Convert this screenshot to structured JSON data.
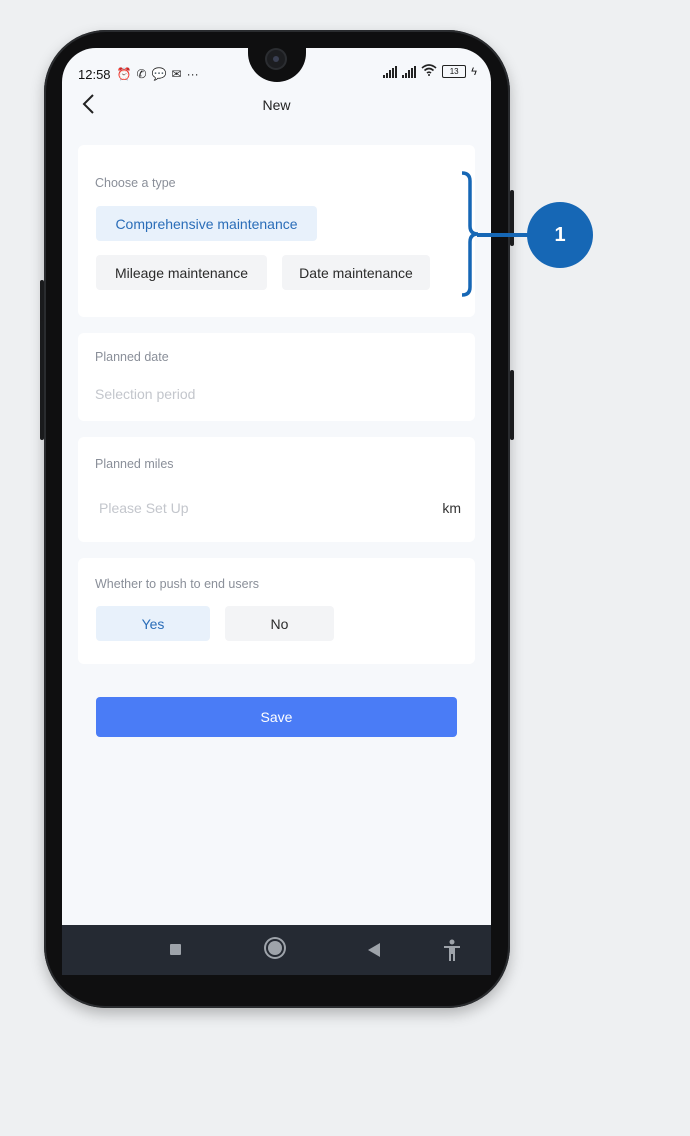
{
  "status_bar": {
    "time": "12:58",
    "battery": "13"
  },
  "header": {
    "title": "New"
  },
  "type_section": {
    "label": "Choose a type",
    "options": [
      "Comprehensive maintenance",
      "Mileage maintenance",
      "Date maintenance"
    ],
    "selected": "Comprehensive maintenance"
  },
  "date_section": {
    "label": "Planned date",
    "placeholder": "Selection period"
  },
  "miles_section": {
    "label": "Planned miles",
    "placeholder": "Please Set Up",
    "unit": "km"
  },
  "push_section": {
    "label": "Whether to push to end users",
    "options": [
      "Yes",
      "No"
    ],
    "selected": "Yes"
  },
  "save_label": "Save",
  "callout": {
    "number": "1"
  },
  "colors": {
    "accent_blue": "#4a7cf6",
    "selected_chip_bg": "#e8f1fb",
    "selected_chip_text": "#2a6db8",
    "callout_blue": "#1667b5"
  }
}
